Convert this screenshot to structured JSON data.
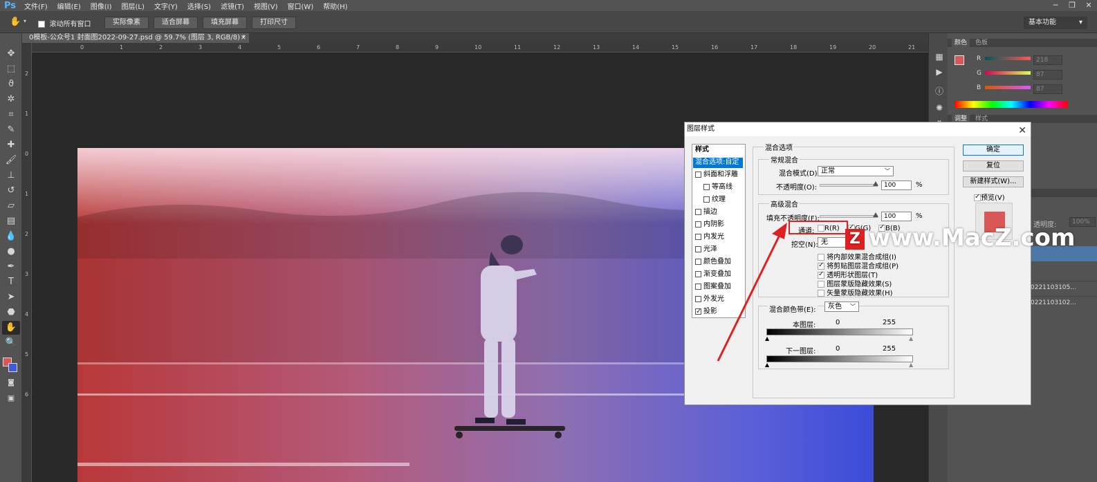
{
  "app": {
    "logo": "Ps"
  },
  "menu": [
    "文件(F)",
    "编辑(E)",
    "图像(I)",
    "图层(L)",
    "文字(Y)",
    "选择(S)",
    "滤镜(T)",
    "视图(V)",
    "窗口(W)",
    "帮助(H)"
  ],
  "options": {
    "scroll_all": "滚动所有窗口",
    "actual_pixels": "实际像素",
    "fit_screen": "适合屏幕",
    "fill_screen": "填充屏幕",
    "print_size": "打印尺寸",
    "workspace": "基本功能"
  },
  "document": {
    "tab_title": "0模板-公众号1 封面图2022-09-27.psd @ 59.7% (图层 3, RGB/8) *",
    "close": "×"
  },
  "rulers": {
    "h_ticks": [
      "0",
      "1",
      "2",
      "3",
      "4",
      "5",
      "6",
      "7",
      "8",
      "9",
      "10",
      "11",
      "12",
      "13",
      "14",
      "15",
      "16",
      "17",
      "18",
      "19",
      "20",
      "21",
      "22"
    ],
    "v_ticks": [
      "2",
      "1",
      "0",
      "1",
      "2",
      "3",
      "4",
      "5",
      "6"
    ]
  },
  "panels": {
    "color_tab": "颜色",
    "swatches_tab": "色板",
    "r_label": "R",
    "g_label": "G",
    "b_label": "B",
    "r_value": "218",
    "g_value": "87",
    "b_value": "87",
    "adjust_tab": "调整",
    "styles_tab": "样式",
    "opacity_label": "透明度:",
    "opacity_value": "100%",
    "layer1": "0221103105...",
    "layer2": "0221103102..."
  },
  "colors": {
    "foreground": "#da5757",
    "background": "#3b5bdb",
    "accent": "#0078d7"
  },
  "dialog": {
    "title": "图层样式",
    "styles_header": "样式",
    "style_items": [
      {
        "label": "混合选项:自定",
        "checked": null,
        "selected": true
      },
      {
        "label": "斜面和浮雕",
        "checked": false
      },
      {
        "label": "等高线",
        "checked": false,
        "indent": true
      },
      {
        "label": "纹理",
        "checked": false,
        "indent": true
      },
      {
        "label": "描边",
        "checked": false
      },
      {
        "label": "内阴影",
        "checked": false
      },
      {
        "label": "内发光",
        "checked": false
      },
      {
        "label": "光泽",
        "checked": false
      },
      {
        "label": "颜色叠加",
        "checked": false
      },
      {
        "label": "渐变叠加",
        "checked": false
      },
      {
        "label": "图案叠加",
        "checked": false
      },
      {
        "label": "外发光",
        "checked": false
      },
      {
        "label": "投影",
        "checked": true
      }
    ],
    "blend_options_group": "混合选项",
    "general_blend_group": "常规混合",
    "blend_mode_label": "混合模式(D):",
    "blend_mode_value": "正常",
    "opacity_label": "不透明度(O):",
    "opacity_value": "100",
    "percent": "%",
    "advanced_group": "高级混合",
    "fill_opacity_label": "填充不透明度(F):",
    "fill_opacity_value": "100",
    "channels_label": "通道:",
    "channel_r": "R(R)",
    "channel_g": "G(G)",
    "channel_b": "B(B)",
    "knockout_label": "挖空(N):",
    "knockout_value": "无",
    "options": [
      {
        "label": "将内部效果混合成组(I)",
        "checked": false
      },
      {
        "label": "将剪贴图层混合成组(P)",
        "checked": true
      },
      {
        "label": "透明形状图层(T)",
        "checked": true
      },
      {
        "label": "图层蒙版隐藏效果(S)",
        "checked": false
      },
      {
        "label": "矢量蒙版隐藏效果(H)",
        "checked": false
      }
    ],
    "blend_if_label": "混合颜色带(E):",
    "blend_if_value": "灰色",
    "this_layer_label": "本图层:",
    "this_layer_min": "0",
    "this_layer_max": "255",
    "underlying_label": "下一图层:",
    "underlying_min": "0",
    "underlying_max": "255",
    "ok": "确定",
    "reset": "复位",
    "new_style": "新建样式(W)...",
    "preview": "预览(V)"
  },
  "watermark": "www.MacZ.com"
}
